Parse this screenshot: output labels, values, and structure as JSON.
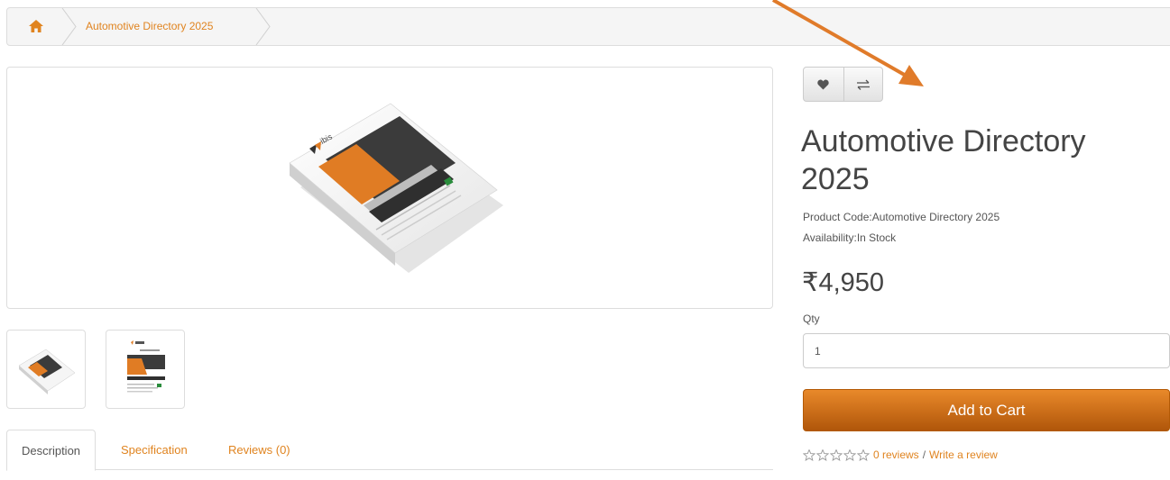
{
  "breadcrumb": {
    "home_icon": "home-icon",
    "items": [
      "Automotive Directory 2025"
    ]
  },
  "product": {
    "title": "Automotive Directory 2025",
    "code_label": "Product Code:",
    "code_value": "Automotive Directory 2025",
    "availability_label": "Availability:",
    "availability_value": "In Stock",
    "price": "₹4,950",
    "qty_label": "Qty",
    "qty_value": "1",
    "add_to_cart": "Add to Cart"
  },
  "actions": {
    "wishlist_icon": "heart-icon",
    "compare_icon": "exchange-icon"
  },
  "tabs": [
    "Description",
    "Specification",
    "Reviews (0)"
  ],
  "rating": {
    "stars": 0,
    "reviews_link": "0 reviews",
    "separator": "/",
    "write_review": "Write a review"
  },
  "colors": {
    "accent": "#e08420",
    "button_top": "#e9892a",
    "button_bottom": "#b0560a",
    "annotation_arrow": "#e07b2a"
  }
}
